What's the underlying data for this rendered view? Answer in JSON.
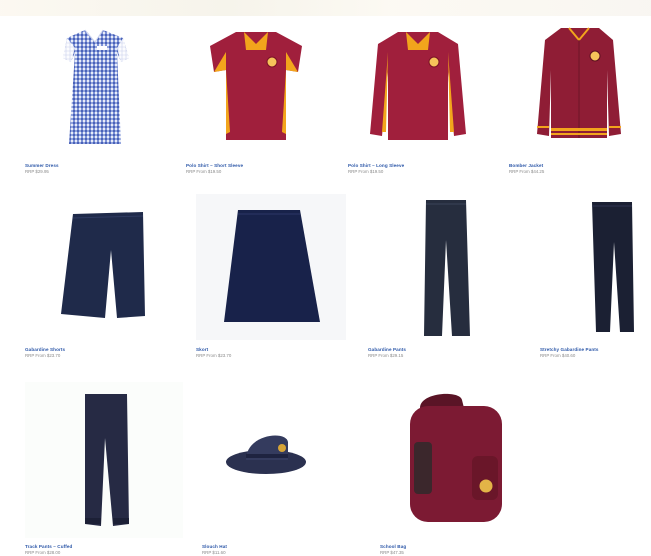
{
  "products": [
    {
      "name": "Summer Dress",
      "price": "RRP $29.95"
    },
    {
      "name": "Polo Shirt – Short Sleeve",
      "price": "RRP From $19.50"
    },
    {
      "name": "Polo Shirt – Long Sleeve",
      "price": "RRP From $19.50"
    },
    {
      "name": "Bomber Jacket",
      "price": "RRP From $44.25"
    },
    {
      "name": "Gabardine Shorts",
      "price": "RRP From $23.70"
    },
    {
      "name": "Skort",
      "price": "RRP From $23.70"
    },
    {
      "name": "Gabardine Pants",
      "price": "RRP From $29.15"
    },
    {
      "name": "Stretchy Gabardine Pants",
      "price": "RRP From $40.60"
    },
    {
      "name": "Track Pants – Cuffed",
      "price": "RRP From $28.00"
    },
    {
      "name": "Slouch Hat",
      "price": "RRP $11.60"
    },
    {
      "name": "School Bag",
      "price": "RRP $47.35"
    }
  ],
  "colors": {
    "maroon": "#a01f3c",
    "gold": "#f2a51c",
    "navy": "#1f2a4a",
    "gingham": "#5b73c4",
    "link": "#2c57a8"
  }
}
